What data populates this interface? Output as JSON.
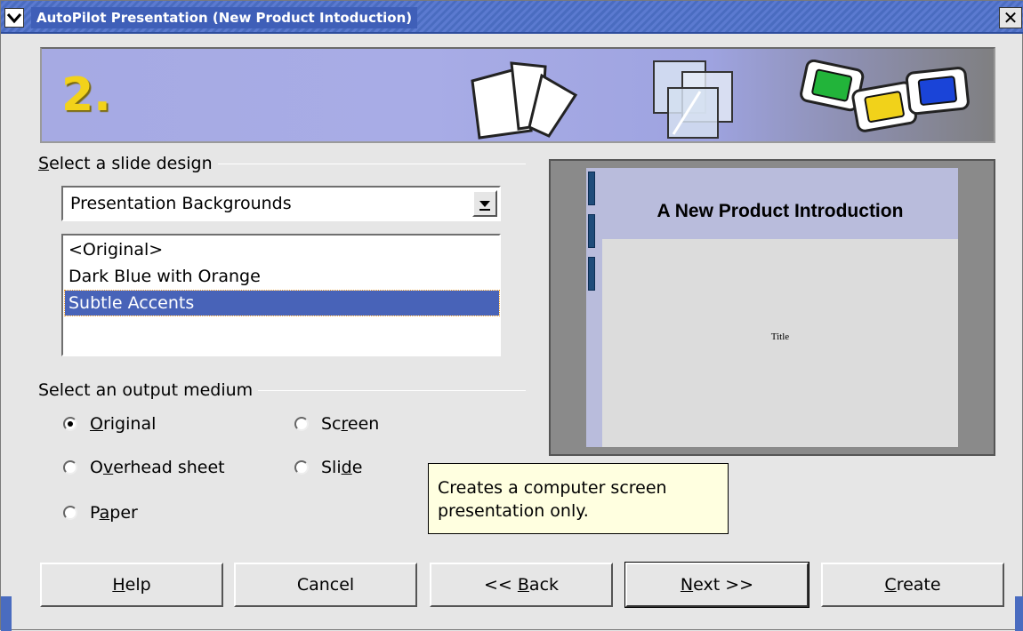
{
  "window": {
    "title": "AutoPilot Presentation (New Product Intoduction)",
    "close_symbol": "✕"
  },
  "banner": {
    "step": "2.",
    "icons": [
      "paper-sheets-icon",
      "transparency-sheets-icon",
      "slides-icon"
    ]
  },
  "design": {
    "group_label_prefix": "S",
    "group_label_rest": "elect a slide design",
    "category_selected": "Presentation Backgrounds",
    "templates": [
      "<Original>",
      "Dark Blue with Orange",
      "Subtle Accents"
    ],
    "selected_template": "Subtle Accents"
  },
  "output": {
    "group_label": "Select an output medium",
    "options": {
      "original": {
        "pre": "",
        "ul": "O",
        "post": "riginal",
        "checked": true
      },
      "screen": {
        "pre": "Sc",
        "ul": "r",
        "post": "een",
        "checked": false
      },
      "overhead": {
        "pre": "O",
        "ul": "v",
        "post": "erhead sheet",
        "checked": false
      },
      "slide": {
        "pre": "Sli",
        "ul": "d",
        "post": "e",
        "checked": false
      },
      "paper": {
        "pre": "P",
        "ul": "a",
        "post": "per",
        "checked": false
      }
    }
  },
  "preview": {
    "title": "A New Product Introduction",
    "subtitle": "Title"
  },
  "tooltip": {
    "line1": "Creates a computer screen",
    "line2": "presentation only."
  },
  "buttons": {
    "help": {
      "ul": "H",
      "post": "elp"
    },
    "cancel": "Cancel",
    "back": {
      "pre": "<< ",
      "ul": "B",
      "post": "ack"
    },
    "next": {
      "ul": "N",
      "post": "ext >>"
    },
    "create": {
      "ul": "C",
      "post": "reate"
    }
  }
}
